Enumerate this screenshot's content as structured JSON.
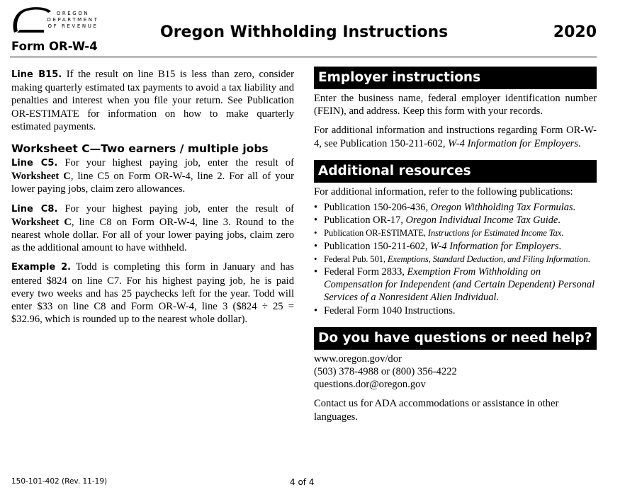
{
  "header": {
    "logo_lines": [
      "OREGON",
      "DEPARTMENT",
      "OF REVENUE"
    ],
    "form_id": "Form OR-W-4",
    "title": "Oregon Withholding Instructions",
    "year": "2020"
  },
  "left": {
    "b15_label": "Line B15.",
    "b15_text": " If the result on line B15 is less than zero, consider making quarterly estimated tax payments to avoid a tax liability and penalties and interest when you file your return. See Publication OR-ESTIMATE for information on how to make quarterly estimated payments.",
    "worksheet_heading": "Worksheet C—Two earners / multiple jobs",
    "c5_label": "Line C5.",
    "c5_text_1": " For your highest paying job, enter the result of ",
    "c5_bold": "Worksheet C",
    "c5_text_2": ", line C5 on Form OR-W-4, line 2. For all of your lower paying jobs, claim zero allowances.",
    "c8_label": "Line C8.",
    "c8_text_1": " For your highest paying job, enter the result of ",
    "c8_bold": "Worksheet C",
    "c8_text_2": ", line C8 on Form OR-W-4, line 3. Round to the nearest whole dollar. For all of your lower paying jobs, claim zero as the additional amount to have withheld.",
    "ex_label": "Example 2.",
    "ex_text": " Todd is completing this form in January and has entered $824 on line C7. For his highest paying job, he is paid every two weeks and has 25 paychecks left for the year. Todd will enter $33 on line C8 and Form OR-W-4, line 3 ($824 ÷ 25 = $32.96, which is rounded up to the nearest whole dollar)."
  },
  "right": {
    "employer_heading": "Employer instructions",
    "employer_p1": "Enter the business name, federal employer identification number (FEIN), and address. Keep this form with your records.",
    "employer_p2_a": "For additional information and instructions regarding Form OR-W-4, see Publication 150-211-602, ",
    "employer_p2_i": "W-4 Information for Employers",
    "employer_p2_b": ".",
    "resources_heading": "Additional resources",
    "resources_intro": "For additional information, refer to the following publications:",
    "resources": [
      {
        "plain": "Publication 150-206-436, ",
        "italic": "Oregon Withholding Tax Formulas",
        "tail": "."
      },
      {
        "plain": "Publication OR-17, ",
        "italic": "Oregon Individual Income Tax Guide",
        "tail": "."
      },
      {
        "plain": "Publication OR-ESTIMATE, ",
        "italic": "Instructions for Estimated Income Tax",
        "tail": "."
      },
      {
        "plain": "Publication 150-211-602, ",
        "italic": "W-4 Information for Employers",
        "tail": "."
      },
      {
        "plain": "Federal Pub. 501, ",
        "italic": "Exemptions, Standard Deduction, and Filing Information",
        "tail": "."
      },
      {
        "plain": "Federal Form 2833, ",
        "italic": "Exemption From Withholding on Compensation for Independent (and Certain Dependent) Personal Services of a Nonresident Alien Individual",
        "tail": "."
      },
      {
        "plain": "Federal Form 1040 Instructions.",
        "italic": "",
        "tail": ""
      }
    ],
    "help_heading": "Do you have questions or need help?",
    "website": "www.oregon.gov/dor",
    "phones": "(503) 378-4988 or (800) 356-4222",
    "email": "questions.dor@oregon.gov",
    "ada": "Contact us for ADA accommodations or assistance in other languages."
  },
  "footer": {
    "code": "150-101-402 (Rev. 11-19)",
    "page": "4 of 4"
  }
}
